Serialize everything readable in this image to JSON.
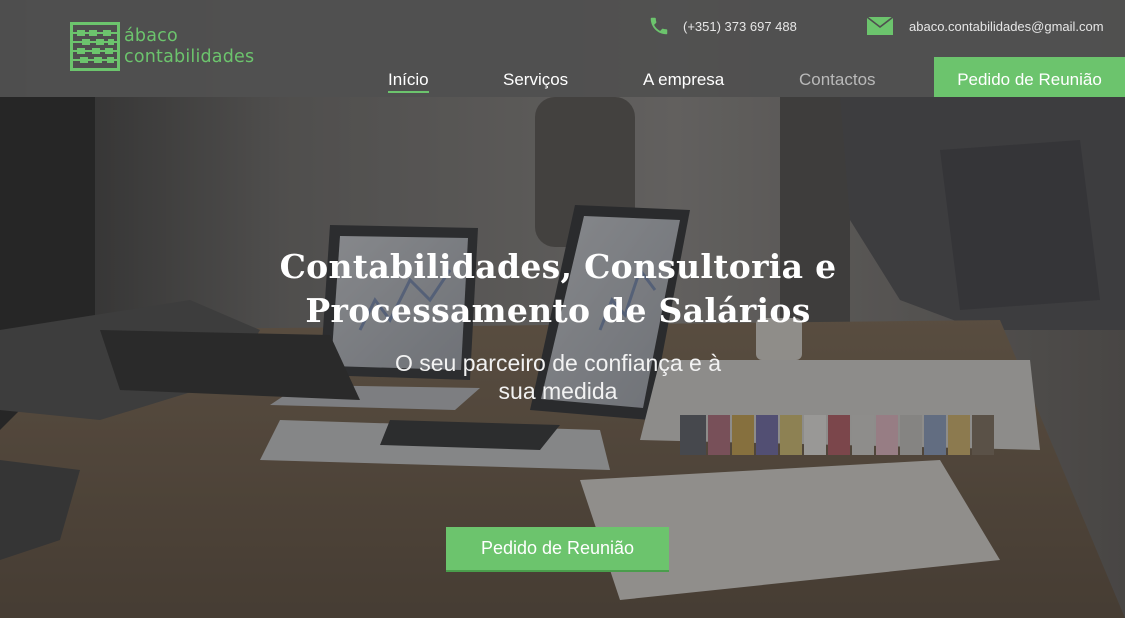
{
  "brand": {
    "name_line1": "ábaco",
    "name_line2": "contabilidades",
    "accent_color": "#6cc46d",
    "logo_icon": "abacus-icon"
  },
  "header": {
    "phone": {
      "icon": "phone-icon",
      "text": "(+351) 373 697 488"
    },
    "email": {
      "icon": "envelope-icon",
      "text": "abaco.contabilidades@gmail.com"
    }
  },
  "nav": {
    "items": [
      {
        "label": "Início",
        "state": "active"
      },
      {
        "label": "Serviços",
        "state": "normal"
      },
      {
        "label": "A empresa",
        "state": "normal"
      },
      {
        "label": "Contactos",
        "state": "dimmed"
      }
    ],
    "cta_label": "Pedido de Reunião"
  },
  "hero": {
    "title": "Contabilidades, Consultoria e Processamento de Salários",
    "subtitle": "O seu parceiro de confiança e à sua medida",
    "cta_label": "Pedido de Reunião",
    "background": "office-meeting-photo"
  }
}
